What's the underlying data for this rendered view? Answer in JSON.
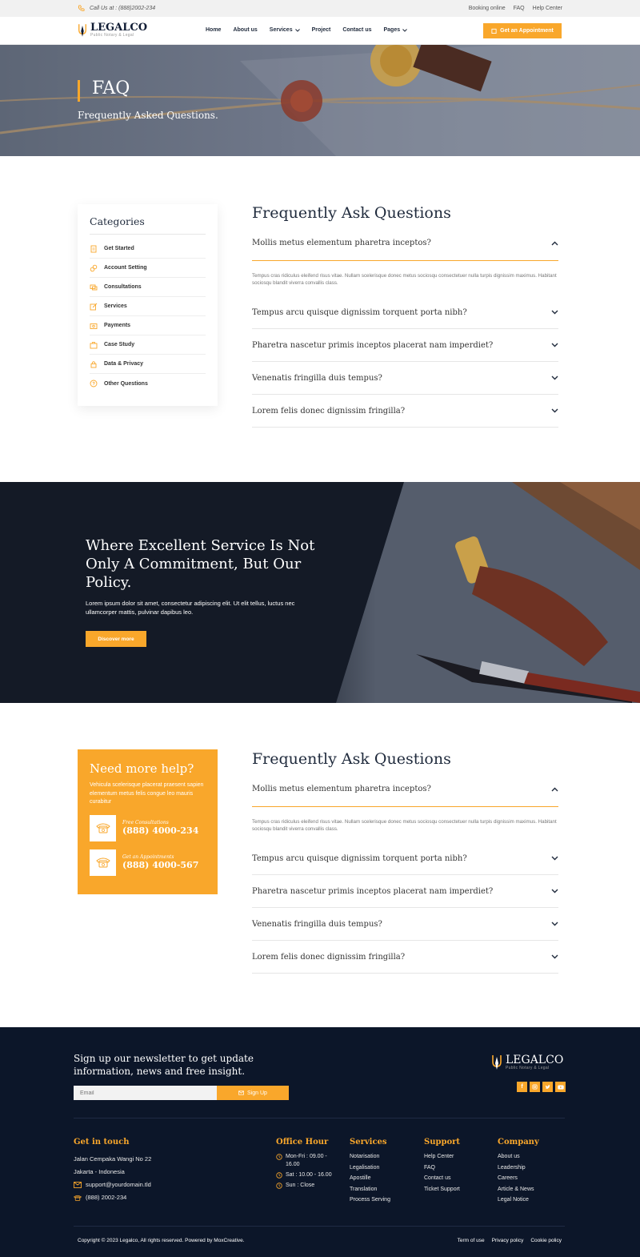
{
  "topbar": {
    "phone_text": "Call Us at : (888)2002-234",
    "links": [
      "Booking online",
      "FAQ",
      "Help Center"
    ]
  },
  "header": {
    "logo_name": "LEGALCO",
    "logo_sub": "Public Notary & Legal",
    "nav": [
      "Home",
      "About us",
      "Services",
      "Project",
      "Contact us",
      "Pages"
    ],
    "cta": "Get an Appointment"
  },
  "hero": {
    "title": "FAQ",
    "subtitle": "Frequently Asked Questions."
  },
  "categories": {
    "title": "Categories",
    "items": [
      "Get Started",
      "Account Setting",
      "Consultations",
      "Services",
      "Payments",
      "Case Study",
      "Data & Privacy",
      "Other Questions"
    ]
  },
  "faq": {
    "title": "Frequently Ask Questions",
    "questions": [
      "Mollis metus elementum pharetra inceptos?",
      "Tempus arcu quisque dignissim torquent porta nibh?",
      "Pharetra nascetur primis inceptos placerat nam imperdiet?",
      "Venenatis fringilla duis tempus?",
      "Lorem felis donec dignissim fringilla?"
    ],
    "answer": "Tempus cras ridiculus eleifend risus vitae. Nullam scelerisque donec metus sociosqu consectetuer nulla turpis dignissim maximus. Habitant sociosqu blandit viverra convallis class."
  },
  "banner": {
    "title": "Where Excellent Service Is Not Only A Commitment, But Our Policy.",
    "text": "Lorem ipsum dolor sit amet, consectetur adipiscing elit. Ut elit tellus, luctus nec ullamcorper mattis, pulvinar dapibus leo.",
    "button": "Discover more"
  },
  "help": {
    "title": "Need more help?",
    "text": "Vehicula scelerisque placerat praesent sapien elementum metus felis congue leo mauris curabitur",
    "contacts": [
      {
        "label": "Free Consultations",
        "phone": "(888) 4000-234"
      },
      {
        "label": "Get an Appointments",
        "phone": "(888) 4000-567"
      }
    ]
  },
  "footer": {
    "newsletter_title": "Sign up our newsletter to get update information, news and free insight.",
    "email_placeholder": "Email",
    "signup": "Sign Up",
    "get_in_touch": {
      "title": "Get in touch",
      "address1": "Jalan Cempaka Wangi No 22",
      "address2": "Jakarta - Indonesia",
      "email": "support@yourdomain.tld",
      "phone": "(888) 2002-234"
    },
    "office": {
      "title": "Office Hour",
      "items": [
        "Mon-Fri : 09.00 - 16.00",
        "Sat : 10.00 - 16.00",
        "Sun : Close"
      ]
    },
    "services": {
      "title": "Services",
      "items": [
        "Notarisation",
        "Legalisation",
        "Apostille",
        "Translation",
        "Process Serving"
      ]
    },
    "support": {
      "title": "Support",
      "items": [
        "Help Center",
        "FAQ",
        "Contact us",
        "Ticket Support"
      ]
    },
    "company": {
      "title": "Company",
      "items": [
        "About us",
        "Leadership",
        "Careers",
        "Article & News",
        "Legal Notice"
      ]
    },
    "copyright": "Copyright © 2023 Legalco, All rights reserved. Powered by MoxCreative.",
    "bottom_links": [
      "Term of use",
      "Privacy policy",
      "Cookie policy"
    ]
  },
  "colors": {
    "accent": "#f9a72b",
    "navy": "#0c1629"
  }
}
